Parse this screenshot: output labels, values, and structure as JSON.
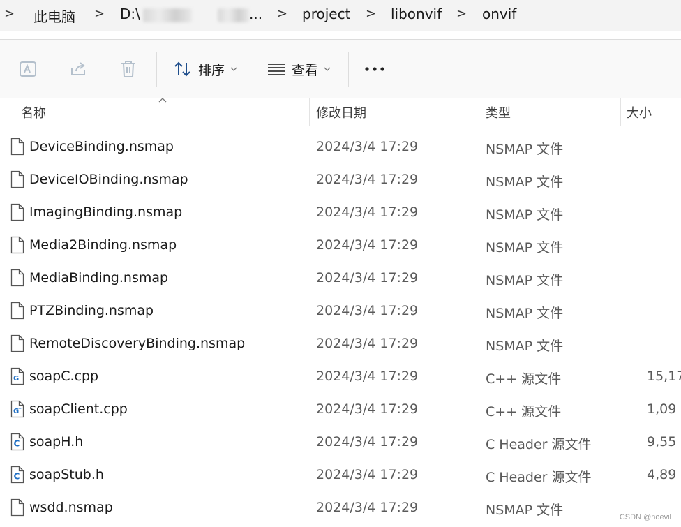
{
  "breadcrumb": {
    "items": [
      "此电脑",
      "D:\\",
      "...",
      "project",
      "libonvif",
      "onvif"
    ],
    "separator": ">"
  },
  "toolbar": {
    "sort_label": "排序",
    "view_label": "查看",
    "more_label": "..."
  },
  "columns": {
    "name": "名称",
    "date": "修改日期",
    "type": "类型",
    "size": "大小"
  },
  "files": [
    {
      "name": "DeviceBinding.nsmap",
      "date": "2024/3/4 17:29",
      "type": "NSMAP 文件",
      "size": "",
      "icon": "file-icon"
    },
    {
      "name": "DeviceIOBinding.nsmap",
      "date": "2024/3/4 17:29",
      "type": "NSMAP 文件",
      "size": "",
      "icon": "file-icon"
    },
    {
      "name": "ImagingBinding.nsmap",
      "date": "2024/3/4 17:29",
      "type": "NSMAP 文件",
      "size": "",
      "icon": "file-icon"
    },
    {
      "name": "Media2Binding.nsmap",
      "date": "2024/3/4 17:29",
      "type": "NSMAP 文件",
      "size": "",
      "icon": "file-icon"
    },
    {
      "name": "MediaBinding.nsmap",
      "date": "2024/3/4 17:29",
      "type": "NSMAP 文件",
      "size": "",
      "icon": "file-icon"
    },
    {
      "name": "PTZBinding.nsmap",
      "date": "2024/3/4 17:29",
      "type": "NSMAP 文件",
      "size": "",
      "icon": "file-icon"
    },
    {
      "name": "RemoteDiscoveryBinding.nsmap",
      "date": "2024/3/4 17:29",
      "type": "NSMAP 文件",
      "size": "",
      "icon": "file-icon"
    },
    {
      "name": "soapC.cpp",
      "date": "2024/3/4 17:29",
      "type": "C++ 源文件",
      "size": "15,17",
      "icon": "cpp-file-icon"
    },
    {
      "name": "soapClient.cpp",
      "date": "2024/3/4 17:29",
      "type": "C++ 源文件",
      "size": "1,09",
      "icon": "cpp-file-icon"
    },
    {
      "name": "soapH.h",
      "date": "2024/3/4 17:29",
      "type": "C Header 源文件",
      "size": "9,55",
      "icon": "c-header-icon"
    },
    {
      "name": "soapStub.h",
      "date": "2024/3/4 17:29",
      "type": "C Header 源文件",
      "size": "4,89",
      "icon": "c-header-icon"
    },
    {
      "name": "wsdd.nsmap",
      "date": "2024/3/4 17:29",
      "type": "NSMAP 文件",
      "size": "",
      "icon": "file-icon"
    }
  ],
  "watermark": "CSDN @noevil",
  "colors": {
    "accent": "#1f6fc4",
    "toolbar_bg": "#f9f9f9",
    "crumb_bg": "#f3f3f3"
  }
}
